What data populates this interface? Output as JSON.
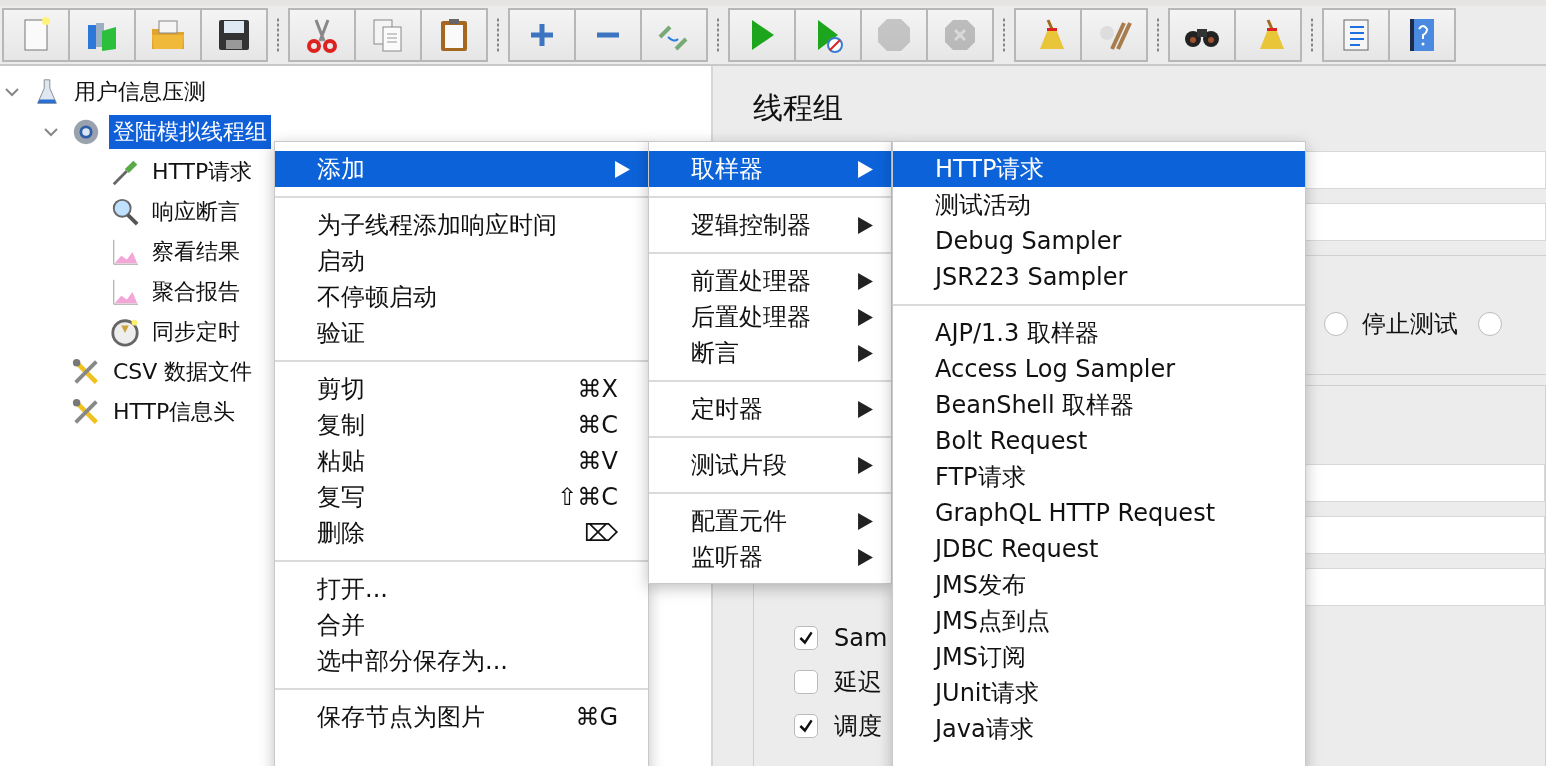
{
  "toolbar": [
    {
      "buttons": [
        {
          "disabled": false
        },
        {
          "disabled": false
        },
        {
          "disabled": false
        },
        {
          "disabled": false
        }
      ]
    },
    {
      "buttons": [
        {
          "disabled": false
        },
        {
          "disabled": false
        },
        {
          "disabled": false
        }
      ]
    },
    {
      "buttons": [
        {
          "disabled": false
        },
        {
          "disabled": false
        },
        {
          "disabled": false
        }
      ]
    },
    {
      "buttons": [
        {
          "disabled": false
        },
        {
          "disabled": false
        },
        {
          "disabled": true
        },
        {
          "disabled": true
        }
      ]
    },
    {
      "buttons": [
        {
          "disabled": false
        },
        {
          "disabled": false
        }
      ]
    },
    {
      "buttons": [
        {
          "disabled": false
        },
        {
          "disabled": false
        }
      ]
    },
    {
      "buttons": [
        {
          "disabled": false
        },
        {
          "disabled": false
        }
      ]
    }
  ],
  "tree": [
    {
      "label": "用户信息压测",
      "kind": "test-plan",
      "expanded": true,
      "selected": false,
      "children": [
        {
          "label": "登陆模拟线程组",
          "kind": "thread-group",
          "expanded": true,
          "selected": true,
          "children": [
            {
              "label": "HTTP请求",
              "kind": "sampler",
              "selected": false
            },
            {
              "label": "响应断言",
              "kind": "assertion",
              "selected": false
            },
            {
              "label": "察看结果",
              "kind": "listener",
              "selected": false
            },
            {
              "label": "聚合报告",
              "kind": "listener",
              "selected": false
            },
            {
              "label": "同步定时",
              "kind": "timer",
              "selected": false
            }
          ]
        },
        {
          "label": "CSV 数据文件",
          "kind": "config",
          "selected": false
        },
        {
          "label": "HTTP信息头",
          "kind": "config",
          "selected": false
        }
      ]
    }
  ],
  "panel": {
    "title": "线程组",
    "radios": [
      {
        "label": "停止测试",
        "selected": false
      },
      {
        "selected": false
      }
    ],
    "checkboxes": [
      {
        "label": "Sam",
        "checked": true
      },
      {
        "label": "延迟",
        "checked": false
      },
      {
        "label": "调度",
        "checked": true
      }
    ]
  },
  "context_menu": {
    "sections": [
      [
        {
          "label": "添加",
          "submenu": true,
          "selected": true
        }
      ],
      [
        {
          "label": "为子线程添加响应时间",
          "selected": false
        },
        {
          "label": "启动",
          "selected": false
        },
        {
          "label": "不停顿启动",
          "selected": false
        },
        {
          "label": "验证",
          "selected": false
        }
      ],
      [
        {
          "label": "剪切",
          "shortcut": "⌘X",
          "selected": false
        },
        {
          "label": "复制",
          "shortcut": "⌘C",
          "selected": false
        },
        {
          "label": "粘贴",
          "shortcut": "⌘V",
          "selected": false
        },
        {
          "label": "复写",
          "shortcut": "⇧⌘C",
          "selected": false
        },
        {
          "label": "删除",
          "shortcut": "⌦",
          "selected": false
        }
      ],
      [
        {
          "label": "打开...",
          "selected": false
        },
        {
          "label": "合并",
          "selected": false
        },
        {
          "label": "选中部分保存为...",
          "selected": false
        }
      ],
      [
        {
          "label": "保存节点为图片",
          "shortcut": "⌘G",
          "selected": false
        }
      ]
    ]
  },
  "add_submenu": {
    "sections": [
      [
        {
          "label": "取样器",
          "submenu": true,
          "selected": true
        }
      ],
      [
        {
          "label": "逻辑控制器",
          "submenu": true,
          "selected": false
        }
      ],
      [
        {
          "label": "前置处理器",
          "submenu": true,
          "selected": false
        },
        {
          "label": "后置处理器",
          "submenu": true,
          "selected": false
        },
        {
          "label": "断言",
          "submenu": true,
          "selected": false
        }
      ],
      [
        {
          "label": "定时器",
          "submenu": true,
          "selected": false
        }
      ],
      [
        {
          "label": "测试片段",
          "submenu": true,
          "selected": false
        }
      ],
      [
        {
          "label": "配置元件",
          "submenu": true,
          "selected": false
        },
        {
          "label": "监听器",
          "submenu": true,
          "selected": false
        }
      ]
    ]
  },
  "sampler_submenu": {
    "sections": [
      [
        {
          "label": "HTTP请求",
          "selected": true
        },
        {
          "label": "测试活动",
          "selected": false
        },
        {
          "label": "Debug Sampler",
          "selected": false
        },
        {
          "label": "JSR223 Sampler",
          "selected": false
        }
      ],
      [
        {
          "label": "AJP/1.3 取样器",
          "selected": false
        },
        {
          "label": "Access Log Sampler",
          "selected": false
        },
        {
          "label": "BeanShell 取样器",
          "selected": false
        },
        {
          "label": "Bolt Request",
          "selected": false
        },
        {
          "label": "FTP请求",
          "selected": false
        },
        {
          "label": "GraphQL HTTP Request",
          "selected": false
        },
        {
          "label": "JDBC Request",
          "selected": false
        },
        {
          "label": "JMS发布",
          "selected": false
        },
        {
          "label": "JMS点到点",
          "selected": false
        },
        {
          "label": "JMS订阅",
          "selected": false
        },
        {
          "label": "JUnit请求",
          "selected": false
        },
        {
          "label": "Java请求",
          "selected": false
        }
      ]
    ]
  }
}
